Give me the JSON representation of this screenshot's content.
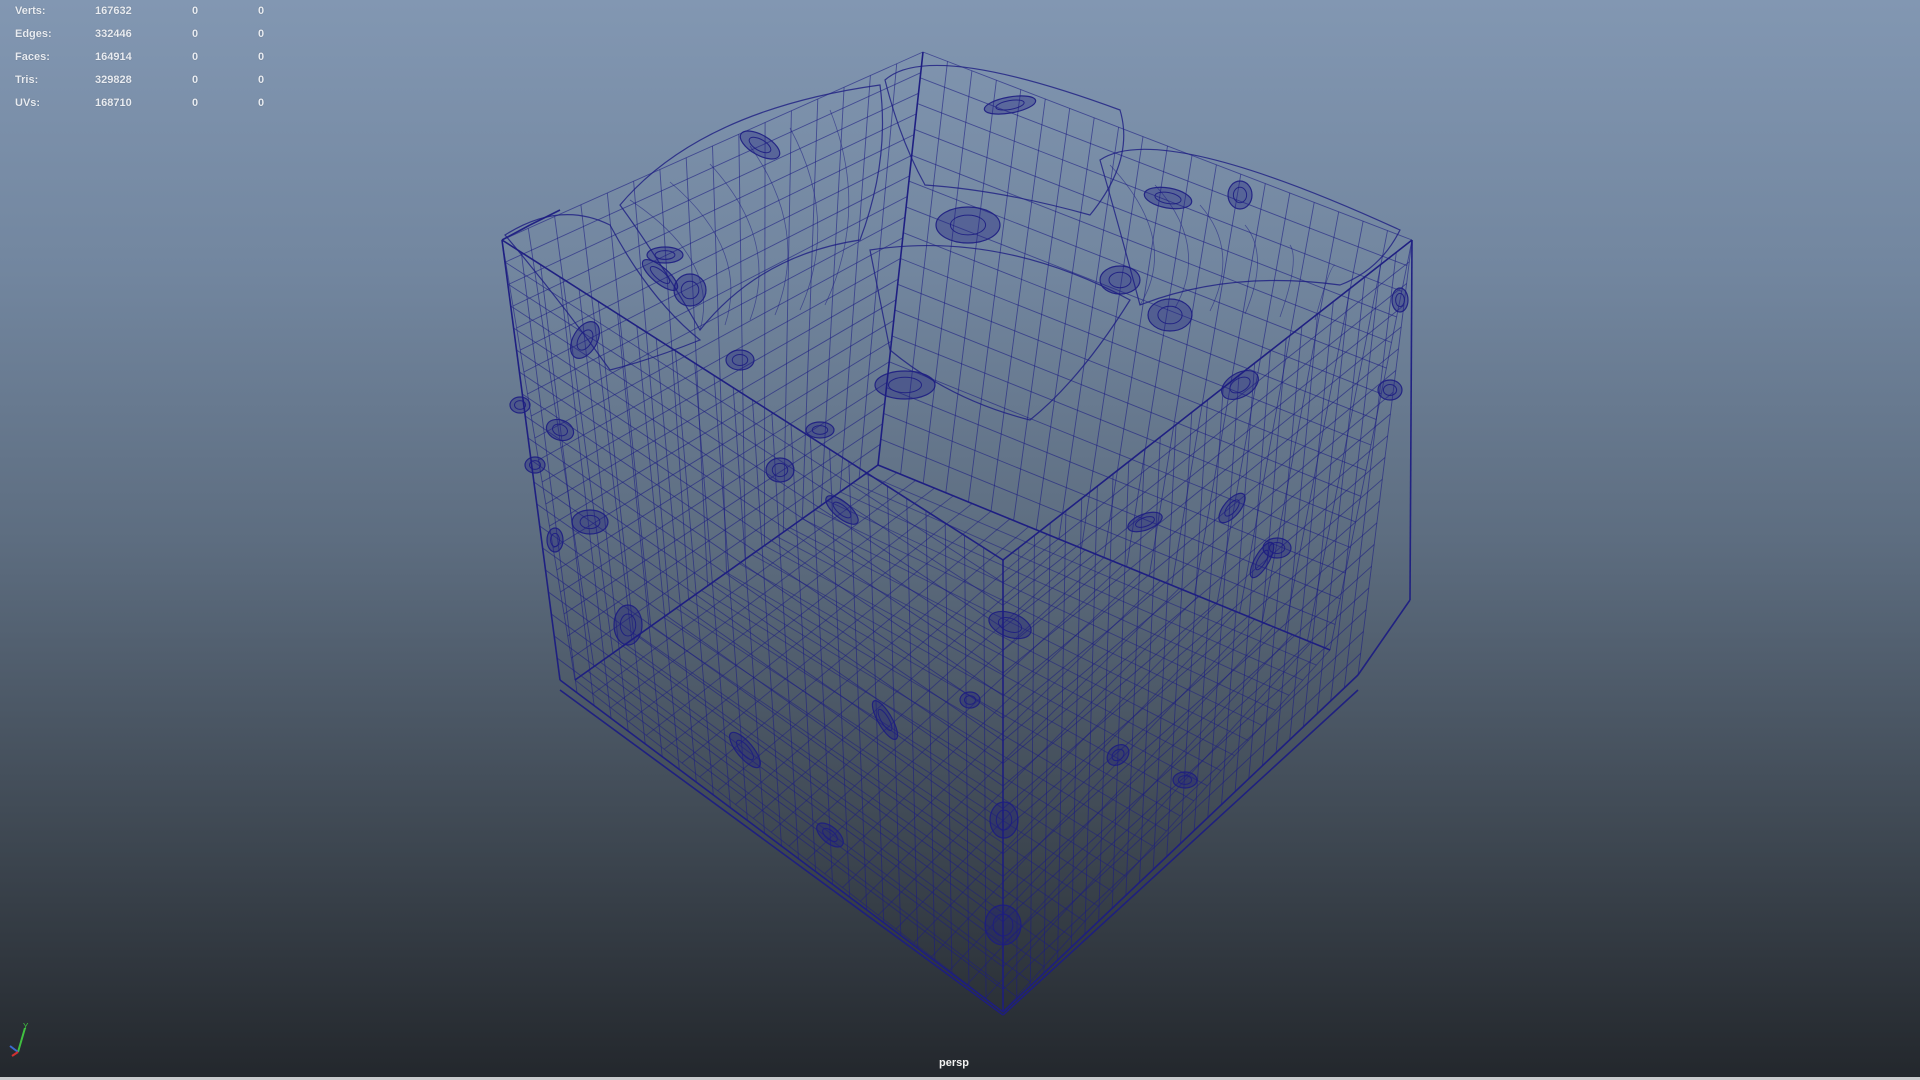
{
  "hud": {
    "rows": [
      {
        "label": "Verts:",
        "total": "167632",
        "selected": "0",
        "object": "0"
      },
      {
        "label": "Edges:",
        "total": "332446",
        "selected": "0",
        "object": "0"
      },
      {
        "label": "Faces:",
        "total": "164914",
        "selected": "0",
        "object": "0"
      },
      {
        "label": "Tris:",
        "total": "329828",
        "selected": "0",
        "object": "0"
      },
      {
        "label": "UVs:",
        "total": "168710",
        "selected": "0",
        "object": "0"
      }
    ]
  },
  "viewport": {
    "camera_label": "persp",
    "display_mode": "wireframe",
    "wire_color": "#1d1d82",
    "background_top": "#8297b2",
    "background_bottom": "#23272c"
  },
  "axis_gizmo": {
    "x_color": "#d03030",
    "y_color": "#40c040",
    "z_color": "#3c6ad0",
    "icon": "axis-triad-icon"
  }
}
